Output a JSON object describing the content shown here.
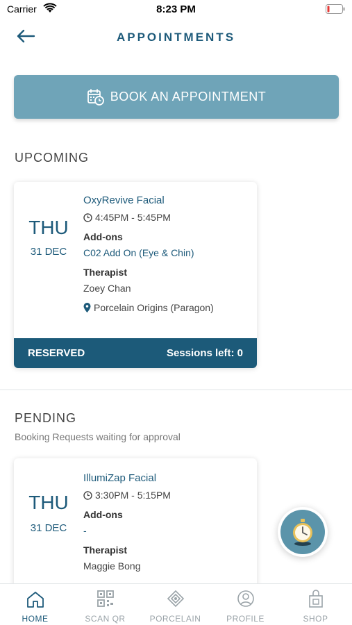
{
  "status_bar": {
    "carrier": "Carrier",
    "time": "8:23 PM"
  },
  "header": {
    "title": "APPOINTMENTS"
  },
  "book_button": {
    "label": "BOOK AN APPOINTMENT"
  },
  "upcoming": {
    "title": "UPCOMING",
    "card": {
      "day": "THU",
      "date": "31 DEC",
      "service": "OxyRevive Facial",
      "time": "4:45PM - 5:45PM",
      "addons_label": "Add-ons",
      "addons_value": "C02 Add On (Eye & Chin)",
      "therapist_label": "Therapist",
      "therapist_name": "Zoey Chan",
      "location": "Porcelain Origins (Paragon)",
      "status": "RESERVED",
      "sessions": "Sessions left: 0"
    }
  },
  "pending": {
    "title": "PENDING",
    "subtitle": "Booking Requests waiting for approval",
    "card": {
      "day": "THU",
      "date": "31 DEC",
      "service": "IllumiZap Facial",
      "time": "3:30PM - 5:15PM",
      "addons_label": "Add-ons",
      "addons_value": "-",
      "therapist_label": "Therapist",
      "therapist_name": "Maggie Bong"
    }
  },
  "tabbar": {
    "tabs": [
      {
        "label": "HOME",
        "icon": "home-icon",
        "active": true
      },
      {
        "label": "SCAN QR",
        "icon": "qr-icon",
        "active": false
      },
      {
        "label": "PORCELAIN",
        "icon": "porcelain-icon",
        "active": false
      },
      {
        "label": "PROFILE",
        "icon": "profile-icon",
        "active": false
      },
      {
        "label": "SHOP",
        "icon": "shop-icon",
        "active": false
      }
    ]
  },
  "colors": {
    "brand": "#1d5a7a",
    "button": "#6fa4b8",
    "footer": "#1c5a79"
  }
}
